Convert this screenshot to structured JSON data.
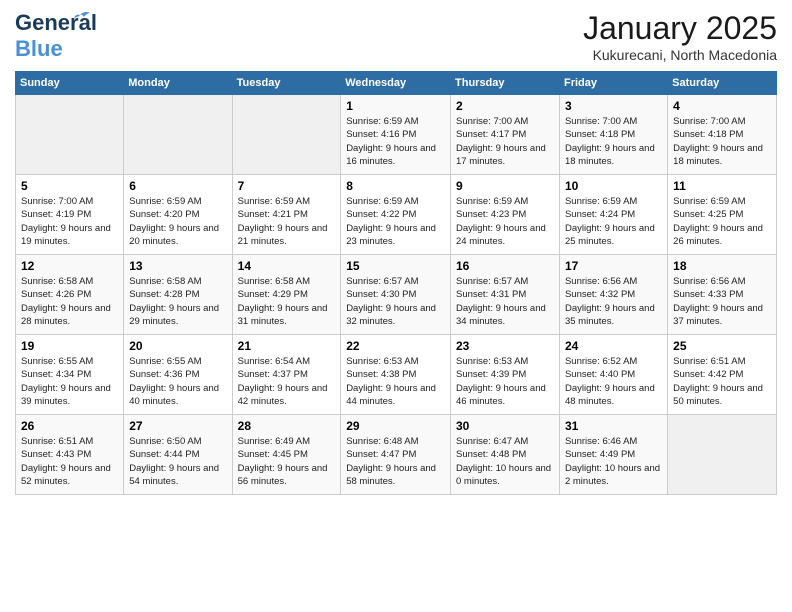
{
  "header": {
    "logo_general": "General",
    "logo_blue": "Blue",
    "title": "January 2025",
    "subtitle": "Kukurecani, North Macedonia"
  },
  "weekdays": [
    "Sunday",
    "Monday",
    "Tuesday",
    "Wednesday",
    "Thursday",
    "Friday",
    "Saturday"
  ],
  "weeks": [
    [
      {
        "day": "",
        "empty": true
      },
      {
        "day": "",
        "empty": true
      },
      {
        "day": "",
        "empty": true
      },
      {
        "day": "1",
        "sunrise": "6:59 AM",
        "sunset": "4:16 PM",
        "daylight": "9 hours and 16 minutes."
      },
      {
        "day": "2",
        "sunrise": "7:00 AM",
        "sunset": "4:17 PM",
        "daylight": "9 hours and 17 minutes."
      },
      {
        "day": "3",
        "sunrise": "7:00 AM",
        "sunset": "4:18 PM",
        "daylight": "9 hours and 18 minutes."
      },
      {
        "day": "4",
        "sunrise": "7:00 AM",
        "sunset": "4:18 PM",
        "daylight": "9 hours and 18 minutes."
      }
    ],
    [
      {
        "day": "5",
        "sunrise": "7:00 AM",
        "sunset": "4:19 PM",
        "daylight": "9 hours and 19 minutes."
      },
      {
        "day": "6",
        "sunrise": "6:59 AM",
        "sunset": "4:20 PM",
        "daylight": "9 hours and 20 minutes."
      },
      {
        "day": "7",
        "sunrise": "6:59 AM",
        "sunset": "4:21 PM",
        "daylight": "9 hours and 21 minutes."
      },
      {
        "day": "8",
        "sunrise": "6:59 AM",
        "sunset": "4:22 PM",
        "daylight": "9 hours and 23 minutes."
      },
      {
        "day": "9",
        "sunrise": "6:59 AM",
        "sunset": "4:23 PM",
        "daylight": "9 hours and 24 minutes."
      },
      {
        "day": "10",
        "sunrise": "6:59 AM",
        "sunset": "4:24 PM",
        "daylight": "9 hours and 25 minutes."
      },
      {
        "day": "11",
        "sunrise": "6:59 AM",
        "sunset": "4:25 PM",
        "daylight": "9 hours and 26 minutes."
      }
    ],
    [
      {
        "day": "12",
        "sunrise": "6:58 AM",
        "sunset": "4:26 PM",
        "daylight": "9 hours and 28 minutes."
      },
      {
        "day": "13",
        "sunrise": "6:58 AM",
        "sunset": "4:28 PM",
        "daylight": "9 hours and 29 minutes."
      },
      {
        "day": "14",
        "sunrise": "6:58 AM",
        "sunset": "4:29 PM",
        "daylight": "9 hours and 31 minutes."
      },
      {
        "day": "15",
        "sunrise": "6:57 AM",
        "sunset": "4:30 PM",
        "daylight": "9 hours and 32 minutes."
      },
      {
        "day": "16",
        "sunrise": "6:57 AM",
        "sunset": "4:31 PM",
        "daylight": "9 hours and 34 minutes."
      },
      {
        "day": "17",
        "sunrise": "6:56 AM",
        "sunset": "4:32 PM",
        "daylight": "9 hours and 35 minutes."
      },
      {
        "day": "18",
        "sunrise": "6:56 AM",
        "sunset": "4:33 PM",
        "daylight": "9 hours and 37 minutes."
      }
    ],
    [
      {
        "day": "19",
        "sunrise": "6:55 AM",
        "sunset": "4:34 PM",
        "daylight": "9 hours and 39 minutes."
      },
      {
        "day": "20",
        "sunrise": "6:55 AM",
        "sunset": "4:36 PM",
        "daylight": "9 hours and 40 minutes."
      },
      {
        "day": "21",
        "sunrise": "6:54 AM",
        "sunset": "4:37 PM",
        "daylight": "9 hours and 42 minutes."
      },
      {
        "day": "22",
        "sunrise": "6:53 AM",
        "sunset": "4:38 PM",
        "daylight": "9 hours and 44 minutes."
      },
      {
        "day": "23",
        "sunrise": "6:53 AM",
        "sunset": "4:39 PM",
        "daylight": "9 hours and 46 minutes."
      },
      {
        "day": "24",
        "sunrise": "6:52 AM",
        "sunset": "4:40 PM",
        "daylight": "9 hours and 48 minutes."
      },
      {
        "day": "25",
        "sunrise": "6:51 AM",
        "sunset": "4:42 PM",
        "daylight": "9 hours and 50 minutes."
      }
    ],
    [
      {
        "day": "26",
        "sunrise": "6:51 AM",
        "sunset": "4:43 PM",
        "daylight": "9 hours and 52 minutes."
      },
      {
        "day": "27",
        "sunrise": "6:50 AM",
        "sunset": "4:44 PM",
        "daylight": "9 hours and 54 minutes."
      },
      {
        "day": "28",
        "sunrise": "6:49 AM",
        "sunset": "4:45 PM",
        "daylight": "9 hours and 56 minutes."
      },
      {
        "day": "29",
        "sunrise": "6:48 AM",
        "sunset": "4:47 PM",
        "daylight": "9 hours and 58 minutes."
      },
      {
        "day": "30",
        "sunrise": "6:47 AM",
        "sunset": "4:48 PM",
        "daylight": "10 hours and 0 minutes."
      },
      {
        "day": "31",
        "sunrise": "6:46 AM",
        "sunset": "4:49 PM",
        "daylight": "10 hours and 2 minutes."
      },
      {
        "day": "",
        "empty": true
      }
    ]
  ],
  "labels": {
    "sunrise": "Sunrise: ",
    "sunset": "Sunset: ",
    "daylight": "Daylight: "
  }
}
